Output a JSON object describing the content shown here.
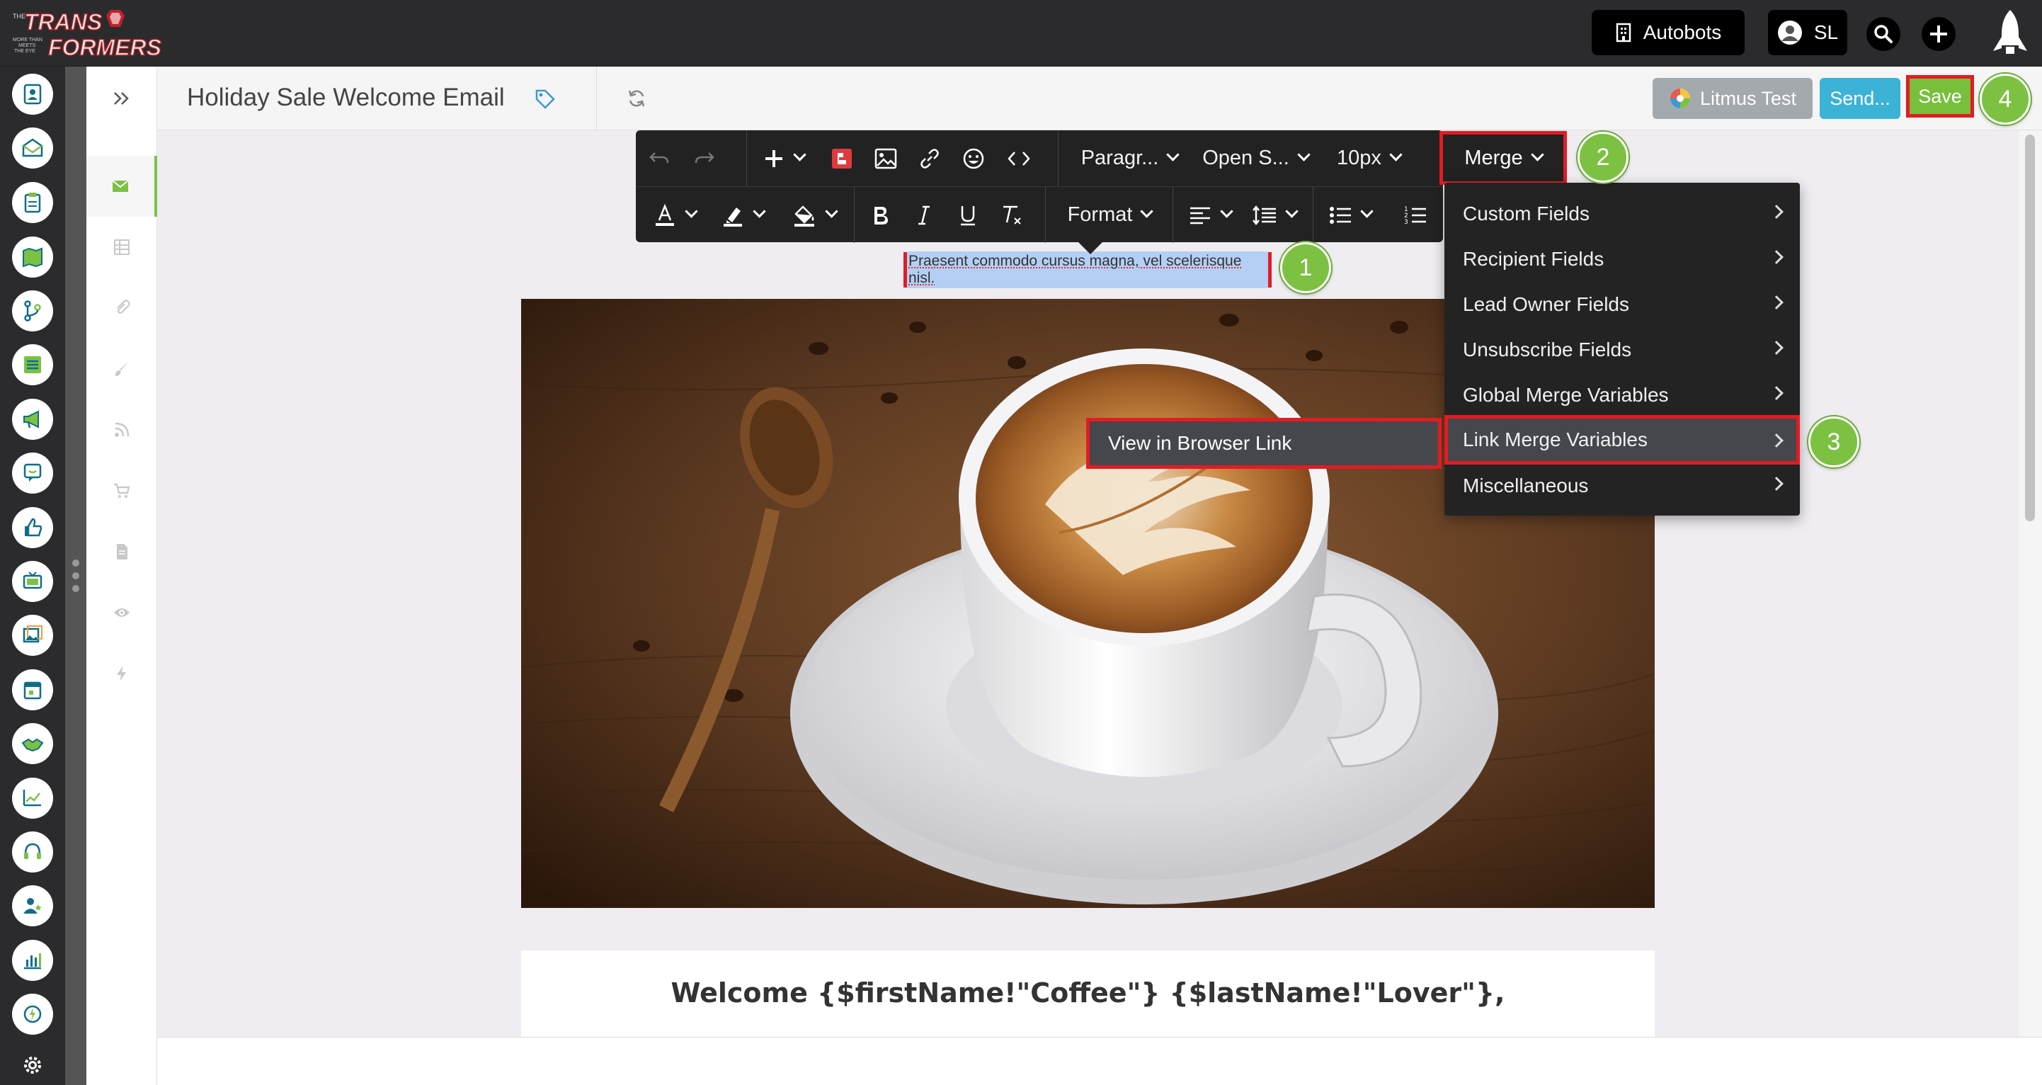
{
  "topbar": {
    "logo_text_top": "TRANS",
    "logo_text_bottom": "FORMERS",
    "logo_tagline": "MORE THAN MEETS THE EYE",
    "org_label": "Autobots",
    "user_initials": "SL"
  },
  "header": {
    "title": "Holiday Sale Welcome Email",
    "litmus_label": "Litmus Test",
    "send_label": "Send...",
    "save_label": "Save"
  },
  "toolbar": {
    "paragraph_label": "Paragr...",
    "font_label": "Open S...",
    "size_label": "10px",
    "merge_label": "Merge",
    "format_label": "Format"
  },
  "editor": {
    "selected_text": "Praesent commodo cursus magna, vel scelerisque nisl.",
    "welcome_heading": "Welcome {$firstName!\"Coffee\"} {$lastName!\"Lover\"},"
  },
  "merge_menu": {
    "items": [
      {
        "label": "Custom Fields"
      },
      {
        "label": "Recipient Fields"
      },
      {
        "label": "Lead Owner Fields"
      },
      {
        "label": "Unsubscribe Fields"
      },
      {
        "label": "Global Merge Variables"
      },
      {
        "label": "Link Merge Variables"
      },
      {
        "label": "Miscellaneous"
      }
    ],
    "submenu_item": "View in Browser Link"
  },
  "steps": [
    "1",
    "2",
    "3",
    "4"
  ],
  "colors": {
    "accent_green": "#78bf3c",
    "highlight_red": "#e31b23",
    "send_blue": "#3cb3d6",
    "litmus_gray": "#a4a9ae"
  }
}
